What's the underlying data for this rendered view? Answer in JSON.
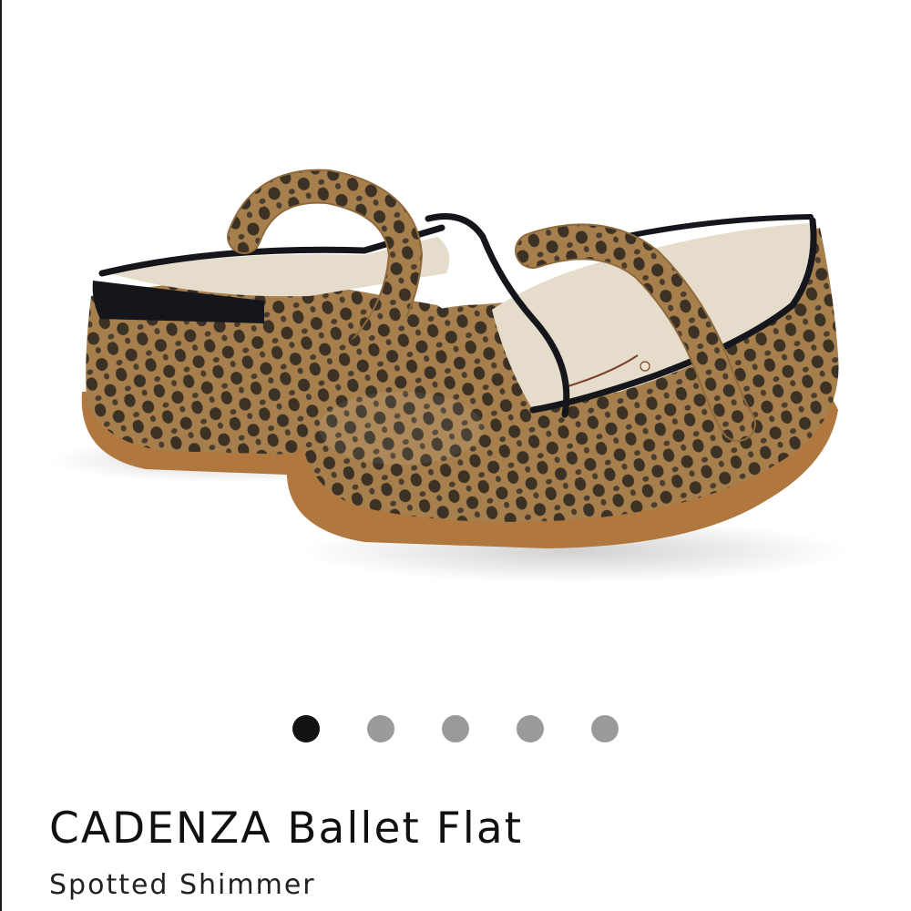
{
  "product": {
    "name": "CADENZA Ballet Flat",
    "variant": "Spotted Shimmer",
    "image_alt": "Spotted Shimmer ballet flats"
  },
  "carousel": {
    "slide_count": 5,
    "active_index": 0,
    "active_color": "#111111",
    "inactive_color": "#9a9a9a"
  },
  "colors": {
    "shoe_tan": "#a67f4d",
    "shoe_spot": "#3b3125",
    "sole": "#b0773e",
    "trim": "#14161c",
    "lining": "#e6dccb"
  }
}
